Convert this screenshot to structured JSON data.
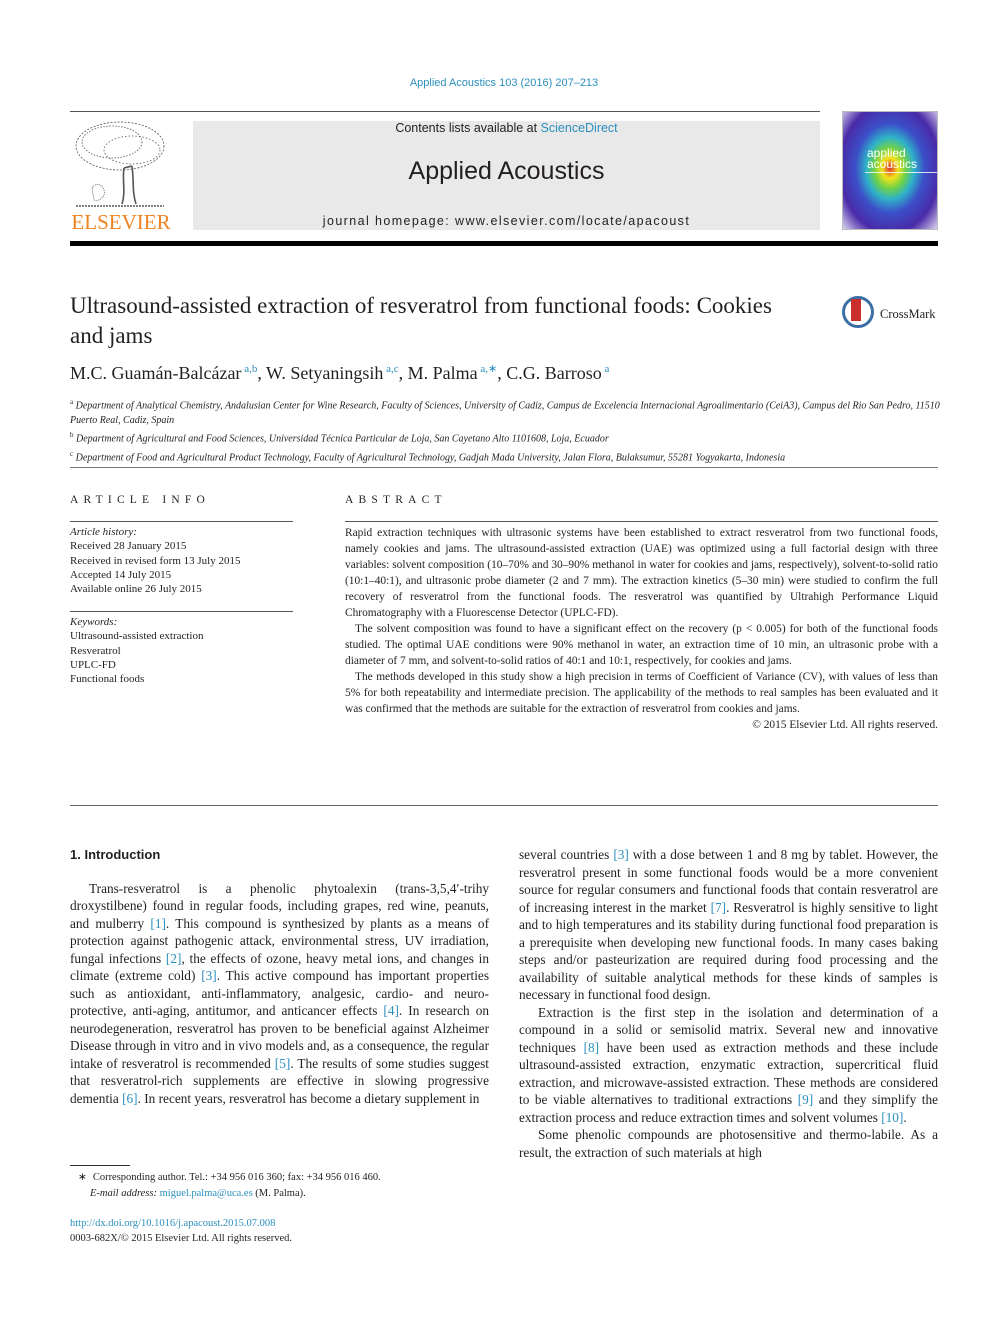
{
  "header": {
    "journal_ref": "Applied Acoustics 103 (2016) 207–213",
    "contents_prefix": "Contents lists available at ",
    "contents_link": "ScienceDirect",
    "journal_title": "Applied Acoustics",
    "homepage_prefix": "journal homepage: ",
    "homepage_url": "www.elsevier.com/locate/apacoust",
    "publisher_logo_text": "ELSEVIER",
    "cover_title_line1": "applied",
    "cover_title_line2": "acoustics",
    "crossmark_label": "CrossMark"
  },
  "colors": {
    "link": "#2a8fbd",
    "elsevier_orange": "#f08321",
    "masthead_bg": "#e9e9e9"
  },
  "article": {
    "title": "Ultrasound-assisted extraction of resveratrol from functional foods: Cookies and jams",
    "authors": [
      {
        "name": "M.C. Guamán-Balcázar",
        "affil": "a,b"
      },
      {
        "name": "W. Setyaningsih",
        "affil": "a,c"
      },
      {
        "name": "M. Palma",
        "affil": "a,∗"
      },
      {
        "name": "C.G. Barroso",
        "affil": "a"
      }
    ],
    "affiliations": [
      {
        "key": "a",
        "text": "Department of Analytical Chemistry, Andalusian Center for Wine Research, Faculty of Sciences, University of Cadiz, Campus de Excelencia Internacional Agroalimentario (CeiA3), Campus del Rio San Pedro, 11510 Puerto Real, Cadiz, Spain"
      },
      {
        "key": "b",
        "text": "Department of Agricultural and Food Sciences, Universidad Técnica Particular de Loja, San Cayetano Alto 1101608, Loja, Ecuador"
      },
      {
        "key": "c",
        "text": "Department of Food and Agricultural Product Technology, Faculty of Agricultural Technology, Gadjah Mada University, Jalan Flora, Bulaksumur, 55281 Yogyakarta, Indonesia"
      }
    ]
  },
  "article_info": {
    "heading": "ARTICLE INFO",
    "history_label": "Article history:",
    "history": [
      "Received 28 January 2015",
      "Received in revised form 13 July 2015",
      "Accepted 14 July 2015",
      "Available online 26 July 2015"
    ],
    "keywords_label": "Keywords:",
    "keywords": [
      "Ultrasound-assisted extraction",
      "Resveratrol",
      "UPLC-FD",
      "Functional foods"
    ]
  },
  "abstract": {
    "heading": "ABSTRACT",
    "paragraphs": [
      "Rapid extraction techniques with ultrasonic systems have been established to extract resveratrol from two functional foods, namely cookies and jams. The ultrasound-assisted extraction (UAE) was optimized using a full factorial design with three variables: solvent composition (10–70% and 30–90% methanol in water for cookies and jams, respectively), solvent-to-solid ratio (10:1–40:1), and ultrasonic probe diameter (2 and 7 mm). The extraction kinetics (5–30 min) were studied to confirm the full recovery of resveratrol from the functional foods. The resveratrol was quantified by Ultrahigh Performance Liquid Chromatography with a Fluorescense Detector (UPLC-FD).",
      "The solvent composition was found to have a significant effect on the recovery (p < 0.005) for both of the functional foods studied. The optimal UAE conditions were 90% methanol in water, an extraction time of 10 min, an ultrasonic probe with a diameter of 7 mm, and solvent-to-solid ratios of 40:1 and 10:1, respectively, for cookies and jams.",
      "The methods developed in this study show a high precision in terms of Coefficient of Variance (CV), with values of less than 5% for both repeatability and intermediate precision. The applicability of the methods to real samples has been evaluated and it was confirmed that the methods are suitable for the extraction of resveratrol from cookies and jams."
    ],
    "copyright": "© 2015 Elsevier Ltd. All rights reserved."
  },
  "introduction": {
    "heading": "1. Introduction",
    "left_p1": [
      {
        "t": "Trans-resveratrol is a phenolic phytoalexin (trans-3,5,4′-trihy droxystilbene) found in regular foods, including grapes, red wine, peanuts, and mulberry "
      },
      {
        "ref": "[1]"
      },
      {
        "t": ". This compound is synthesized by plants as a means of protection against pathogenic attack, environmental stress, UV irradiation, fungal infections "
      },
      {
        "ref": "[2]"
      },
      {
        "t": ", the effects of ozone, heavy metal ions, and changes in climate (extreme cold) "
      },
      {
        "ref": "[3]"
      },
      {
        "t": ". This active compound has important properties such as antioxidant, anti-inflammatory, analgesic, cardio- and neuro-protective, anti-aging, antitumor, and anticancer effects "
      },
      {
        "ref": "[4]"
      },
      {
        "t": ". In research on neurodegeneration, resveratrol has proven to be beneficial against Alzheimer Disease through in vitro and in vivo models and, as a consequence, the regular intake of resveratrol is recommended "
      },
      {
        "ref": "[5]"
      },
      {
        "t": ". The results of some studies suggest that resveratrol-rich supplements are effective in slowing progressive dementia "
      },
      {
        "ref": "[6]"
      },
      {
        "t": ". In recent years, resveratrol has become a dietary supplement in"
      }
    ],
    "right_p1": [
      {
        "t": "several countries "
      },
      {
        "ref": "[3]"
      },
      {
        "t": " with a dose between 1 and 8 mg by tablet. However, the resveratrol present in some functional foods would be a more convenient source for regular consumers and functional foods that contain resveratrol are of increasing interest in the market "
      },
      {
        "ref": "[7]"
      },
      {
        "t": ". Resveratrol is highly sensitive to light and to high temperatures and its stability during functional food preparation is a prerequisite when developing new functional foods. In many cases baking steps and/or pasteurization are required during food processing and the availability of suitable analytical methods for these kinds of samples is necessary in functional food design."
      }
    ],
    "right_p2": [
      {
        "t": "Extraction is the first step in the isolation and determination of a compound in a solid or semisolid matrix. Several new and innovative techniques "
      },
      {
        "ref": "[8]"
      },
      {
        "t": " have been used as extraction methods and these include ultrasound-assisted extraction, enzymatic extraction, supercritical fluid extraction, and microwave-assisted extraction. These methods are considered to be viable alternatives to traditional extractions "
      },
      {
        "ref": "[9]"
      },
      {
        "t": " and they simplify the extraction process and reduce extraction times and solvent volumes "
      },
      {
        "ref": "[10]"
      },
      {
        "t": "."
      }
    ],
    "right_p3": [
      {
        "t": "Some phenolic compounds are photosensitive and thermo-labile. As a result, the extraction of such materials at high"
      }
    ]
  },
  "footnote": {
    "marker": "∗",
    "corresponding": "Corresponding author. Tel.: +34 956 016 360; fax: +34 956 016 460.",
    "email_label": "E-mail address: ",
    "email": "miguel.palma@uca.es",
    "email_suffix": " (M. Palma)."
  },
  "doi": {
    "url": "http://dx.doi.org/10.1016/j.apacoust.2015.07.008",
    "issn_line": "0003-682X/© 2015 Elsevier Ltd. All rights reserved."
  }
}
